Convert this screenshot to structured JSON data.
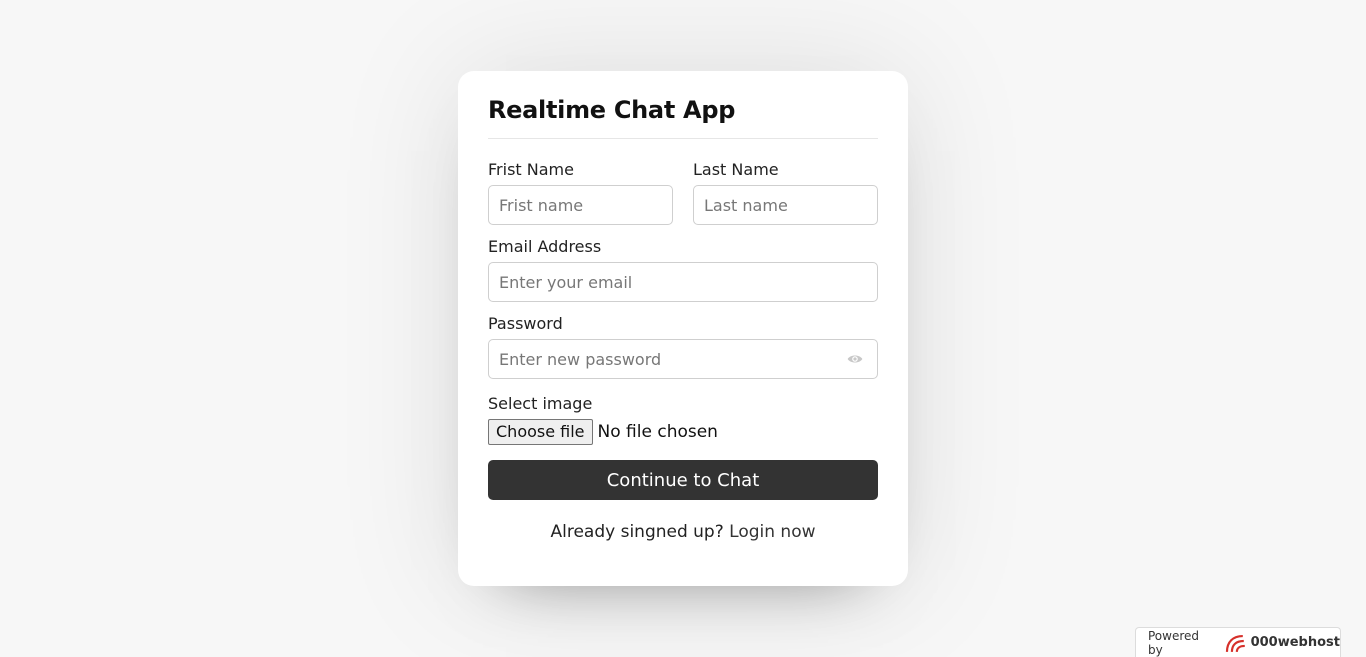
{
  "form": {
    "title": "Realtime Chat App",
    "first_name_label": "Frist Name",
    "first_name_placeholder": "Frist name",
    "last_name_label": "Last Name",
    "last_name_placeholder": "Last name",
    "email_label": "Email Address",
    "email_placeholder": "Enter your email",
    "password_label": "Password",
    "password_placeholder": "Enter new password",
    "password_icon": "eye-icon",
    "image_label": "Select image",
    "file_button": "Choose file",
    "file_status": "No file chosen",
    "submit_label": "Continue to Chat",
    "login_prompt": "Already singned up?",
    "login_link": "Login now"
  },
  "footer": {
    "powered_by": "Powered by",
    "brand": "000webhost"
  },
  "colors": {
    "background": "#f7f7f7",
    "button": "#333333",
    "logo_red": "#d6302a"
  }
}
